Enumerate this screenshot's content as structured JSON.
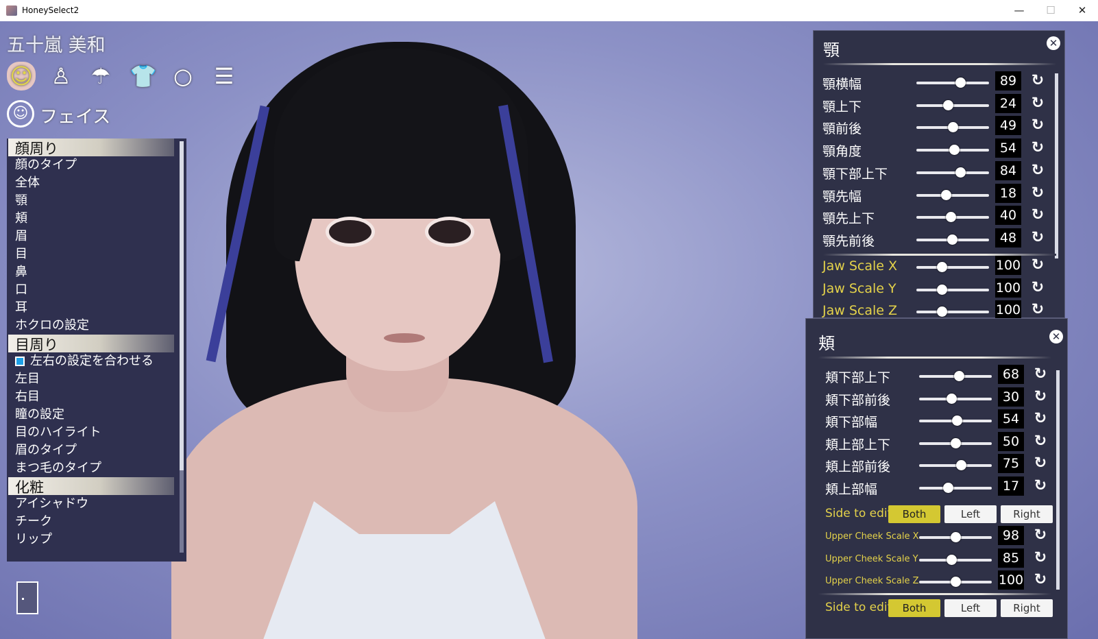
{
  "window": {
    "title": "HoneySelect2",
    "minimize": "—",
    "maximize": "☐",
    "close": "✕"
  },
  "character_name": "五十嵐 美和",
  "category_icons": [
    {
      "name": "face-icon",
      "glyph": "☺"
    },
    {
      "name": "body-icon",
      "glyph": "♙"
    },
    {
      "name": "hair-icon",
      "glyph": "☂"
    },
    {
      "name": "clothes-icon",
      "glyph": "👕"
    },
    {
      "name": "accessory-icon",
      "glyph": "○"
    },
    {
      "name": "system-icon",
      "glyph": "☰"
    }
  ],
  "section": {
    "icon": "☺",
    "label": "フェイス"
  },
  "menu": {
    "group1": "顔周り",
    "group1_items": [
      "顔のタイプ",
      "全体",
      "顎",
      "頬",
      "眉",
      "目",
      "鼻",
      "口",
      "耳",
      "ホクロの設定"
    ],
    "group2": "目周り",
    "sync_label": "左右の設定を合わせる",
    "group2_items": [
      "左目",
      "右目",
      "瞳の設定",
      "目のハイライト",
      "眉のタイプ",
      "まつ毛のタイプ"
    ],
    "group3": "化粧",
    "group3_items": [
      "アイシャドウ",
      "チーク",
      "リップ"
    ]
  },
  "jaw_panel": {
    "title": "顎",
    "close": "✕",
    "rows": [
      {
        "label": "顎横幅",
        "value": "89",
        "level": 0.6
      },
      {
        "label": "顎上下",
        "value": "24",
        "level": 0.43
      },
      {
        "label": "顎前後",
        "value": "49",
        "level": 0.5
      },
      {
        "label": "顎角度",
        "value": "54",
        "level": 0.52
      },
      {
        "label": "顎下部上下",
        "value": "84",
        "level": 0.6
      },
      {
        "label": "顎先幅",
        "value": "18",
        "level": 0.41
      },
      {
        "label": "顎先上下",
        "value": "40",
        "level": 0.47
      },
      {
        "label": "顎先前後",
        "value": "48",
        "level": 0.49
      }
    ],
    "scale_rows": [
      {
        "label": "Jaw Scale X",
        "value": "100",
        "level": 0.35
      },
      {
        "label": "Jaw Scale Y",
        "value": "100",
        "level": 0.35
      },
      {
        "label": "Jaw Scale Z",
        "value": "100",
        "level": 0.35
      }
    ]
  },
  "cheek_panel": {
    "title": "頬",
    "close": "✕",
    "rows": [
      {
        "label": "頬下部上下",
        "value": "68",
        "level": 0.55
      },
      {
        "label": "頬下部前後",
        "value": "30",
        "level": 0.44
      },
      {
        "label": "頬下部幅",
        "value": "54",
        "level": 0.52
      },
      {
        "label": "頬上部上下",
        "value": "50",
        "level": 0.5
      },
      {
        "label": "頬上部前後",
        "value": "75",
        "level": 0.58
      },
      {
        "label": "頬上部幅",
        "value": "17",
        "level": 0.4
      }
    ],
    "side_label": "Side to edit",
    "both": "Both",
    "left": "Left",
    "right": "Right",
    "scale_rows": [
      {
        "label": "Upper Cheek Scale X",
        "value": "98",
        "level": 0.5
      },
      {
        "label": "Upper Cheek Scale Y",
        "value": "85",
        "level": 0.44
      },
      {
        "label": "Upper Cheek Scale Z",
        "value": "100",
        "level": 0.5
      }
    ],
    "side_label2": "Side to edit",
    "both2": "Both",
    "left2": "Left",
    "right2": "Right"
  },
  "reset_glyph": "↻",
  "colors": {
    "accent": "#e4d24a",
    "panel": "#2f3147",
    "menu": "#2f304f",
    "sync_checkbox": "#1ea0e6"
  }
}
